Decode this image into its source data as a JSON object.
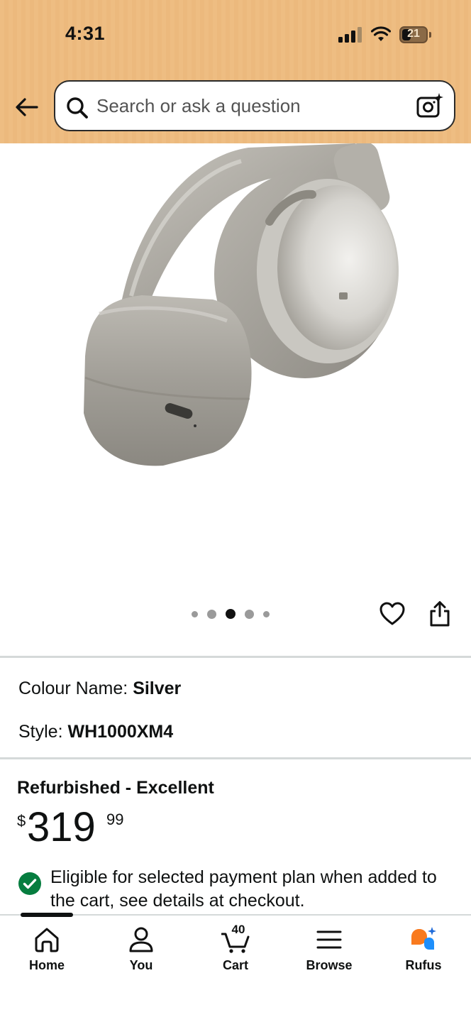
{
  "status_bar": {
    "time": "4:31",
    "battery_level": "21"
  },
  "header": {
    "search_placeholder": "Search or ask a question"
  },
  "product": {
    "image_carousel": {
      "total": 5,
      "active_index": 2
    },
    "colour_label": "Colour Name:",
    "colour_value": "Silver",
    "style_label": "Style:",
    "style_value": "WH1000XM4",
    "condition": "Refurbished - Excellent",
    "price_symbol": "$",
    "price_whole": "319",
    "price_fraction": "99",
    "eligibility_text": "Eligible for selected payment plan when added to the cart, see details at checkout."
  },
  "bottom_nav": {
    "items": [
      {
        "label": "Home",
        "icon": "home-icon"
      },
      {
        "label": "You",
        "icon": "user-icon"
      },
      {
        "label": "Cart",
        "icon": "cart-icon",
        "count": "40"
      },
      {
        "label": "Browse",
        "icon": "menu-icon"
      },
      {
        "label": "Rufus",
        "icon": "rufus-icon"
      }
    ],
    "active": "Home"
  },
  "colors": {
    "header_bg": "#eebd82",
    "eligible_check": "#067d3f",
    "rufus_orange": "#f97a1e",
    "rufus_blue": "#1e8ffb"
  }
}
